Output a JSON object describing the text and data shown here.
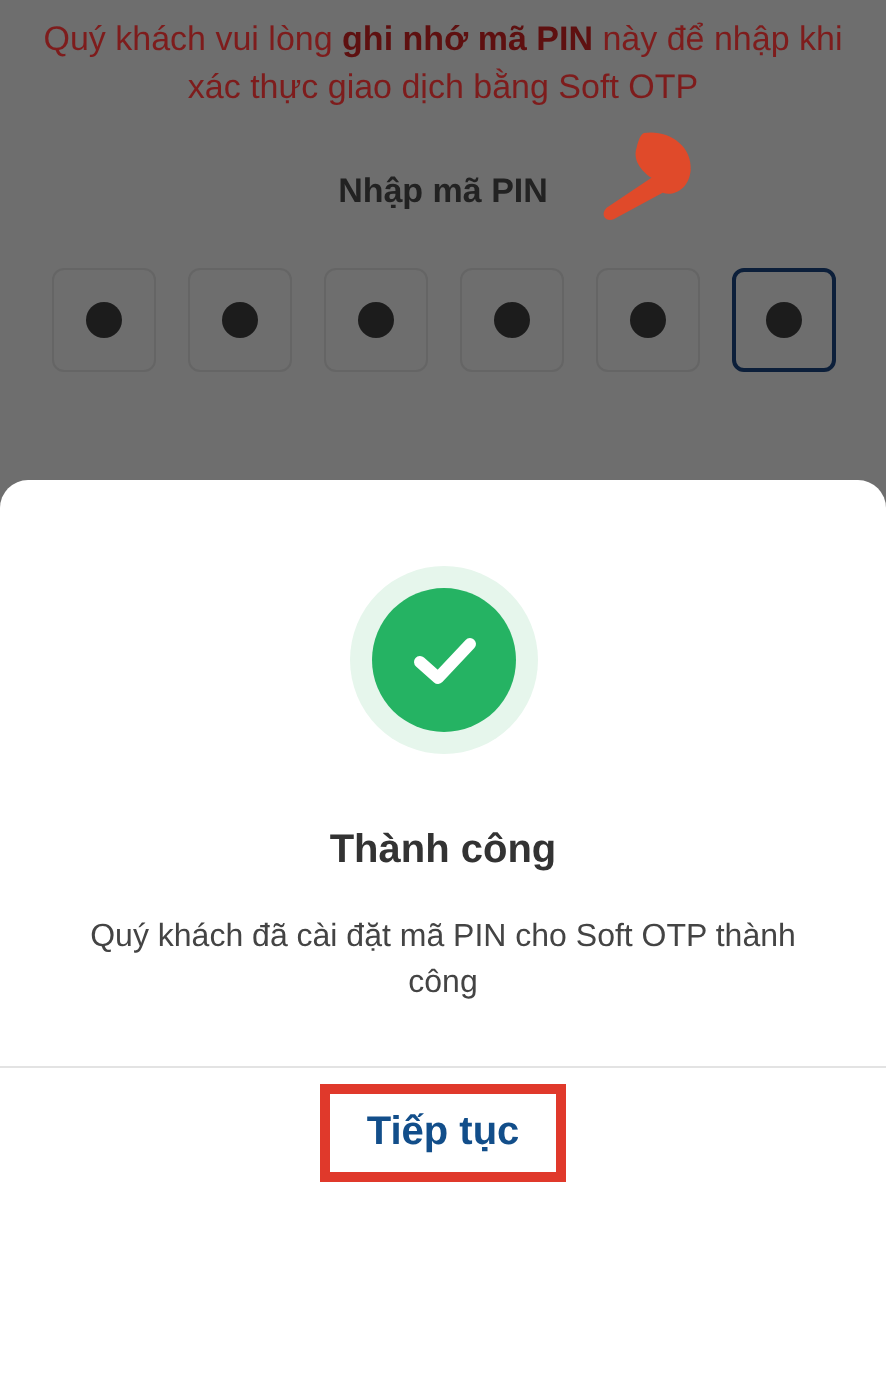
{
  "notice": "Quý khách vui lòng **ghi nhớ mã PIN** này để nhập khi xác thực giao dịch bằng Soft OTP",
  "pin": {
    "label": "Nhập mã PIN",
    "digits": [
      {
        "filled": true,
        "selected": false
      },
      {
        "filled": true,
        "selected": false
      },
      {
        "filled": true,
        "selected": false
      },
      {
        "filled": true,
        "selected": false
      },
      {
        "filled": true,
        "selected": false
      },
      {
        "filled": true,
        "selected": true
      }
    ]
  },
  "dialog": {
    "title": "Thành công",
    "message": "Quý khách đã cài đặt mã PIN cho Soft OTP thành công",
    "button": {
      "label": "Tiếp tục",
      "highlighted": true
    }
  }
}
